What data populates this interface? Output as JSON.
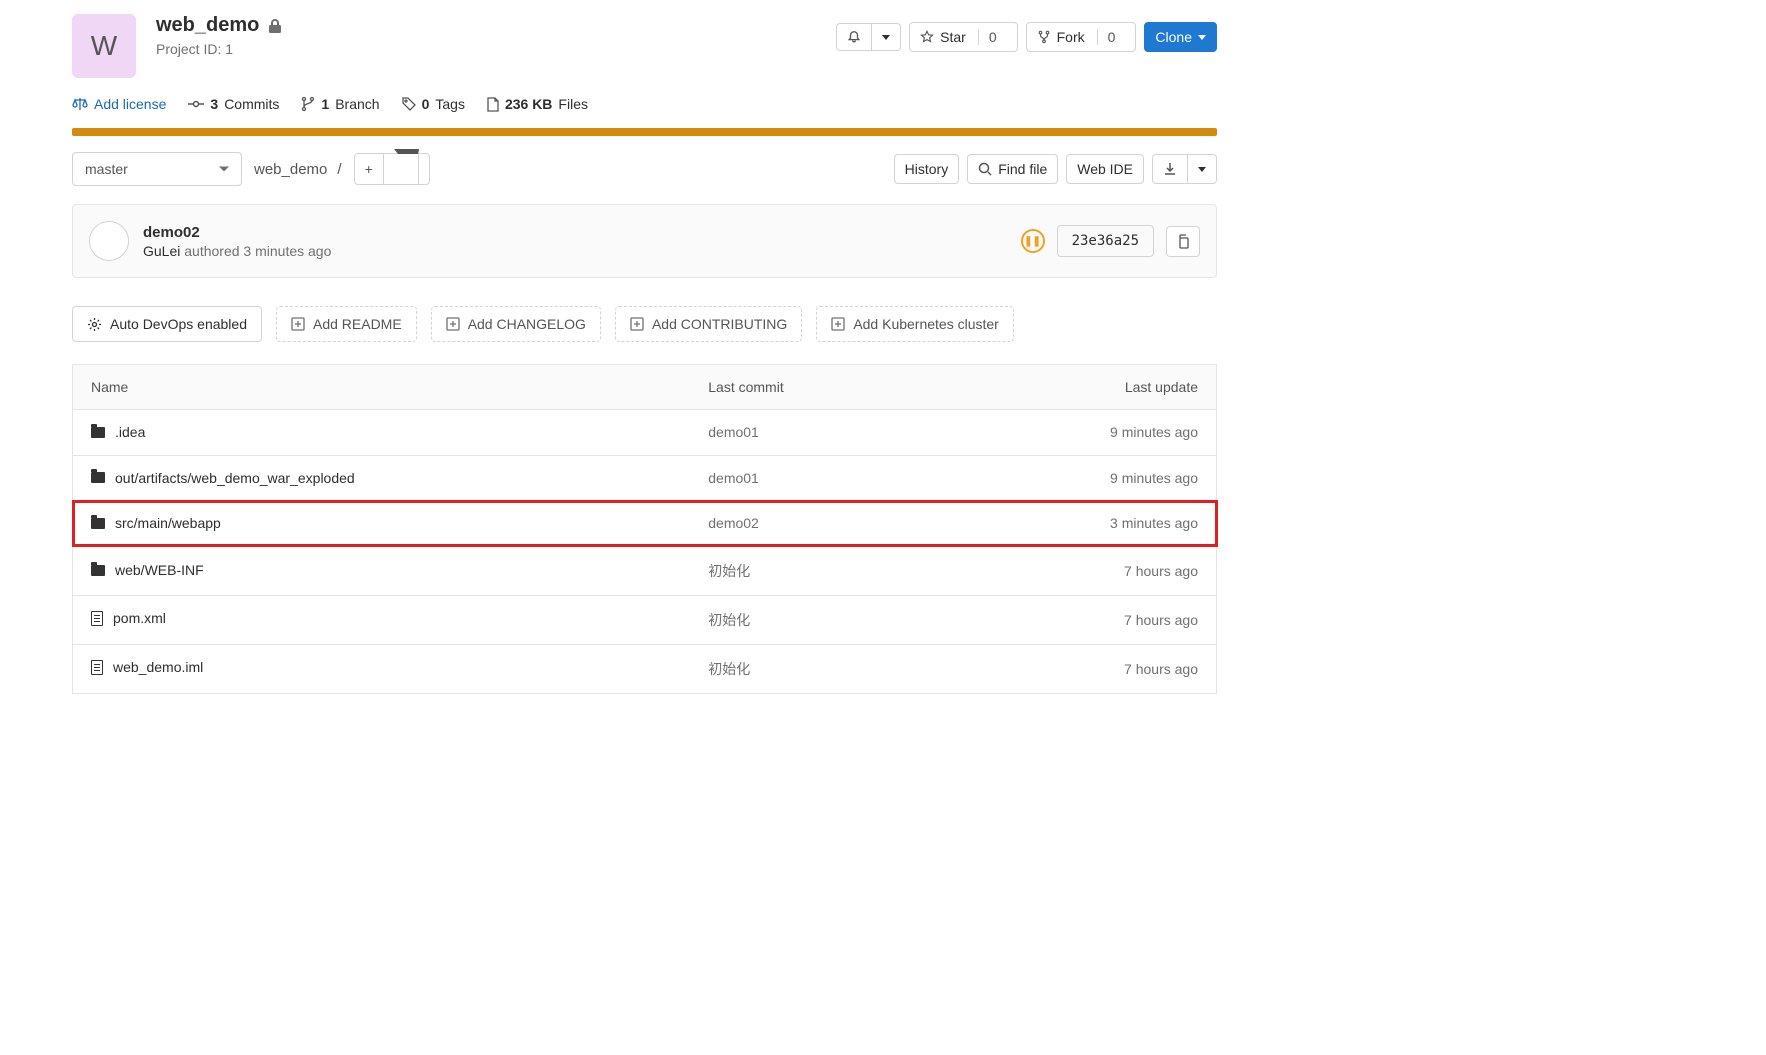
{
  "project": {
    "avatar_letter": "W",
    "name": "web_demo",
    "id_label": "Project ID: 1"
  },
  "header_actions": {
    "star_label": "Star",
    "star_count": "0",
    "fork_label": "Fork",
    "fork_count": "0",
    "clone_label": "Clone"
  },
  "stats": {
    "add_license": "Add license",
    "commits_count": "3",
    "commits_label": "Commits",
    "branches_count": "1",
    "branches_label": "Branch",
    "tags_count": "0",
    "tags_label": "Tags",
    "size_value": "236 KB",
    "size_label": "Files"
  },
  "toolbar": {
    "branch": "master",
    "breadcrumb_root": "web_demo",
    "breadcrumb_sep": "/",
    "history": "History",
    "find_file": "Find file",
    "web_ide": "Web IDE"
  },
  "last_commit": {
    "message": "demo02",
    "author": "GuLei",
    "authored": "authored",
    "time": "3 minutes ago",
    "sha": "23e36a25"
  },
  "suggestions": {
    "devops": "Auto DevOps enabled",
    "readme": "Add README",
    "changelog": "Add CHANGELOG",
    "contributing": "Add CONTRIBUTING",
    "k8s": "Add Kubernetes cluster"
  },
  "table": {
    "headers": {
      "name": "Name",
      "commit": "Last commit",
      "update": "Last update"
    },
    "rows": [
      {
        "icon": "folder",
        "name": ".idea",
        "commit": "demo01",
        "update": "9 minutes ago",
        "highlight": false
      },
      {
        "icon": "folder",
        "name": "out/artifacts/web_demo_war_exploded",
        "commit": "demo01",
        "update": "9 minutes ago",
        "highlight": false
      },
      {
        "icon": "folder",
        "name": "src/main/webapp",
        "commit": "demo02",
        "update": "3 minutes ago",
        "highlight": true
      },
      {
        "icon": "folder",
        "name": "web/WEB-INF",
        "commit": "初始化",
        "update": "7 hours ago",
        "highlight": false
      },
      {
        "icon": "file",
        "name": "pom.xml",
        "commit": "初始化",
        "update": "7 hours ago",
        "highlight": false
      },
      {
        "icon": "file",
        "name": "web_demo.iml",
        "commit": "初始化",
        "update": "7 hours ago",
        "highlight": false
      }
    ]
  }
}
